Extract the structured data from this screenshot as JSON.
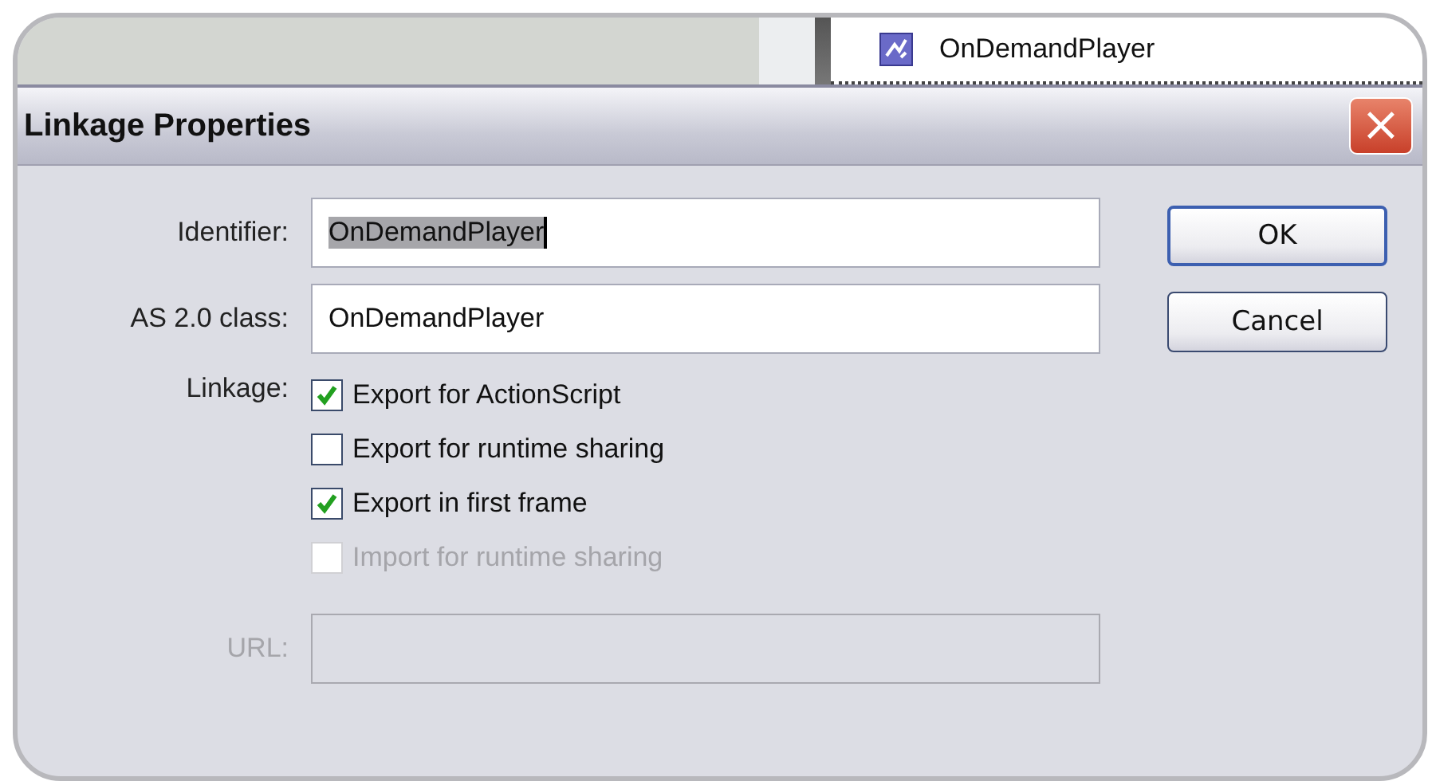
{
  "background_item": {
    "label": "OnDemandPlayer"
  },
  "window": {
    "title": "Linkage Properties",
    "close": "×"
  },
  "fields": [
    {
      "label": "Identifier:",
      "value": "OnDemandPlayer",
      "text_selected": true
    },
    {
      "label": "AS 2.0 class:",
      "value": "OnDemandPlayer",
      "text_selected": false
    }
  ],
  "linkage": {
    "label": "Linkage:",
    "options": [
      {
        "label": "Export for ActionScript",
        "checked": true,
        "disabled": false
      },
      {
        "label": "Export for runtime sharing",
        "checked": false,
        "disabled": false
      },
      {
        "label": "Export in first frame",
        "checked": true,
        "disabled": false
      },
      {
        "label": "Import for runtime sharing",
        "checked": false,
        "disabled": true
      }
    ]
  },
  "url": {
    "label": "URL:",
    "disabled": true
  },
  "buttons": [
    {
      "label": "OK",
      "default": true
    },
    {
      "label": "Cancel",
      "default": false
    }
  ]
}
